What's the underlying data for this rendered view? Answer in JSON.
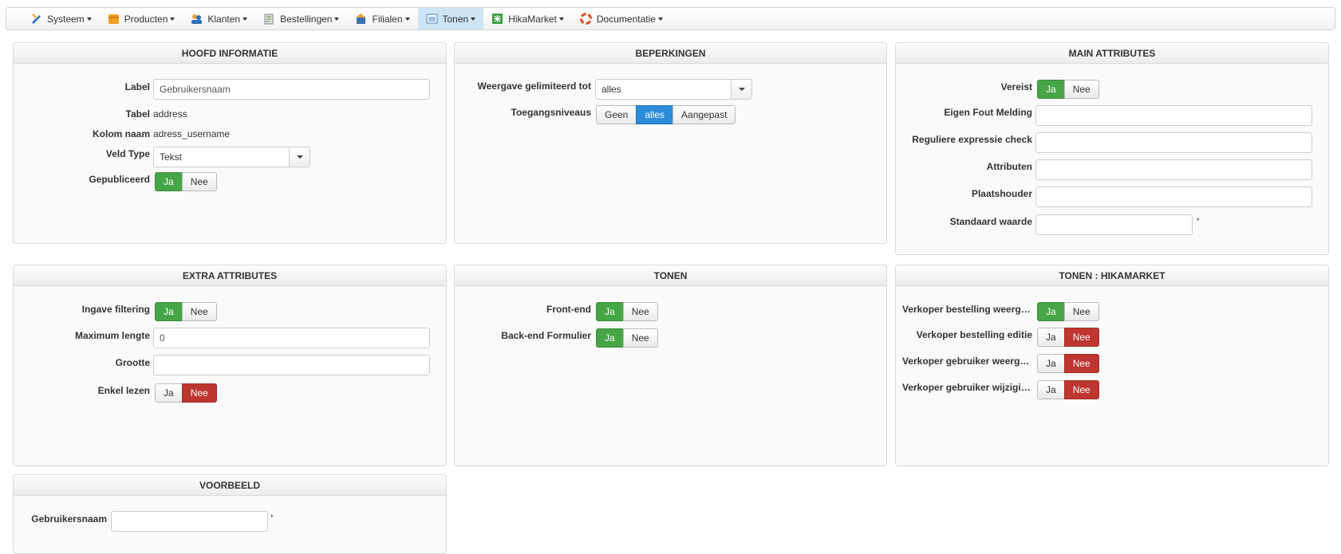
{
  "menu": [
    {
      "label": "Systeem",
      "icon": "tools-icon",
      "color": "#3a76c4"
    },
    {
      "label": "Producten",
      "icon": "box-icon",
      "color": "#f0a020"
    },
    {
      "label": "Klanten",
      "icon": "users-icon",
      "color": "#2e6eb5"
    },
    {
      "label": "Bestellingen",
      "icon": "orders-icon",
      "color": "#8a9a6a"
    },
    {
      "label": "Filialen",
      "icon": "shop-icon",
      "color": "#3a6fb0"
    },
    {
      "label": "Tonen",
      "icon": "display-icon",
      "color": "#4a80c0"
    },
    {
      "label": "HikaMarket",
      "icon": "hikamarket-icon",
      "color": "#3aa040"
    },
    {
      "label": "Documentatie",
      "icon": "lifebuoy-icon",
      "color": "#e05020"
    }
  ],
  "hoofd": {
    "title": "HOOFD INFORMATIE",
    "label_lbl": "Label",
    "label_val": "Gebruikersnaam",
    "tabel_lbl": "Tabel",
    "tabel_val": "address",
    "kolom_lbl": "Kolom naam",
    "kolom_val": "adress_username",
    "veldtype_lbl": "Veld Type",
    "veldtype_val": "Tekst",
    "gepubliceerd_lbl": "Gepubliceerd"
  },
  "beperkingen": {
    "title": "BEPERKINGEN",
    "weergave_lbl": "Weergave gelimiteerd tot",
    "weergave_val": "alles",
    "toegang_lbl": "Toegangsniveaus",
    "opt_geen": "Geen",
    "opt_alles": "alles",
    "opt_aangepast": "Aangepast"
  },
  "main": {
    "title": "MAIN ATTRIBUTES",
    "vereist": "Vereist",
    "fout": "Eigen Fout Melding",
    "regex": "Reguliere expressie check",
    "attributen": "Attributen",
    "plaatshouder": "Plaatshouder",
    "standaard": "Standaard waarde",
    "star": "*"
  },
  "extra": {
    "title": "EXTRA ATTRIBUTES",
    "filtering": "Ingave filtering",
    "maxlen": "Maximum lengte",
    "maxlen_val": "0",
    "grootte": "Grootte",
    "enkel": "Enkel lezen"
  },
  "tonen": {
    "title": "TONEN",
    "front": "Front-end",
    "back": "Back-end Formulier"
  },
  "hikamarket": {
    "title": "TONEN : HIKAMARKET",
    "r1": "Verkoper bestelling weergave",
    "r2": "Verkoper bestelling editie",
    "r3": "Verkoper gebruiker weergave",
    "r4": "Verkoper gebruiker wijziging"
  },
  "voorbeeld": {
    "title": "VOORBEELD",
    "lbl": "Gebruikersnaam",
    "star": "*"
  },
  "yes": "Ja",
  "no": "Nee"
}
